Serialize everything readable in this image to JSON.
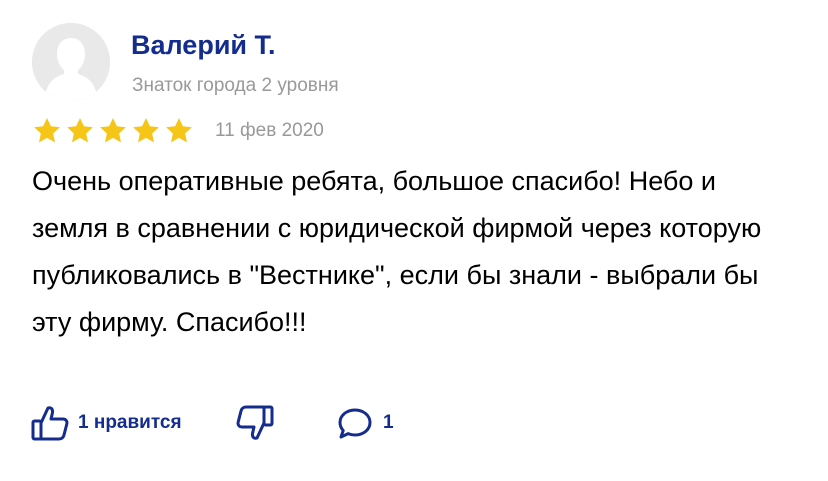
{
  "review": {
    "author": {
      "name": "Валерий Т.",
      "level": "Знаток города 2 уровня",
      "avatar_icon": "user-silhouette-icon"
    },
    "rating": 5,
    "rating_max": 5,
    "star_color": "#f5c518",
    "date": "11 фев 2020",
    "text": "Очень оперативные ребята, большое спасибо! Небо и земля в сравнении с юридической фирмой через которую публиковались в \"Вестнике\", если бы знали - выбрали бы эту фирму. Спасибо!!!"
  },
  "actions": {
    "like": {
      "icon": "thumbs-up-icon",
      "label": "1 нравится"
    },
    "dislike": {
      "icon": "thumbs-down-icon"
    },
    "comments": {
      "icon": "comment-icon",
      "count": "1"
    }
  },
  "colors": {
    "accent": "#142c8e",
    "muted": "#999999"
  }
}
